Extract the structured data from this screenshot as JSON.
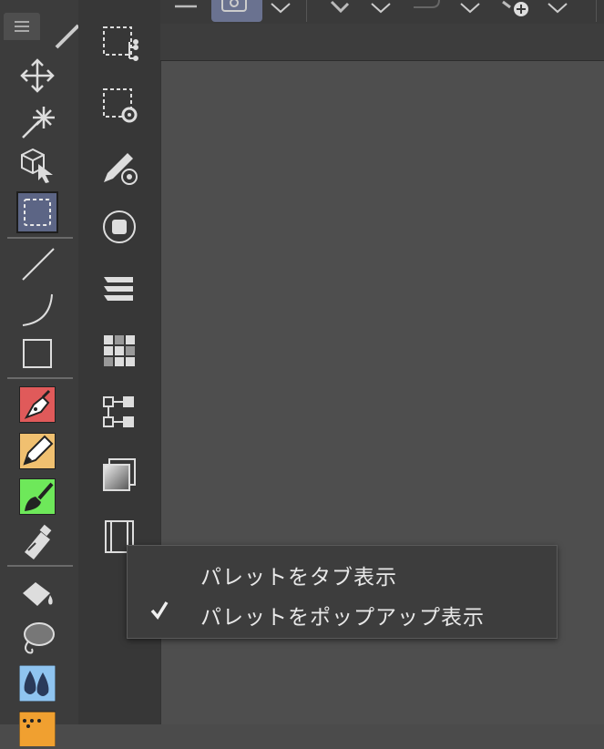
{
  "context_menu": {
    "items": [
      {
        "label": "パレットをタブ表示",
        "checked": false
      },
      {
        "label": "パレットをポップアップ表示",
        "checked": true
      }
    ]
  },
  "colors": {
    "selected_tool_bg": "#5c6585",
    "pen_tool": "#e05a5a",
    "pencil_tool": "#f0c070",
    "brush_tool": "#6ee85a",
    "blend_tool": "#8fc4f0",
    "pattern_tool": "#f0a030"
  }
}
